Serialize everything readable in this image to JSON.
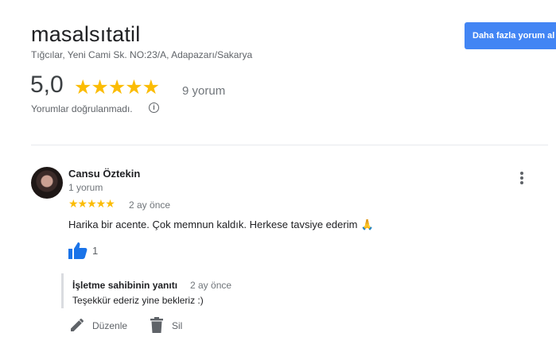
{
  "business": {
    "name": "masalsıtatil",
    "address": "Tığcılar, Yeni Cami Sk. NO:23/A, Adapazarı/Sakarya",
    "more_reviews_button": "Daha fazla yorum al"
  },
  "summary": {
    "rating": "5,0",
    "stars": "★★★★★",
    "review_count": "9 yorum",
    "verification_note": "Yorumlar doğrulanmadı.",
    "info_icon": "i"
  },
  "review": {
    "author": "Cansu Öztekin",
    "author_review_count": "1 yorum",
    "stars": "★★★★★",
    "time": "2 ay önce",
    "text": "Harika bir acente. Çok memnun kaldık. Herkese tavsiye ederim",
    "emoji": "🙏",
    "like_count": "1",
    "reply": {
      "owner_label": "İşletme sahibinin yanıtı",
      "time": "2 ay önce",
      "text": "Teşekkür ederiz yine bekleriz :)"
    },
    "actions": {
      "edit_label": "Düzenle",
      "delete_label": "Sil"
    }
  },
  "colors": {
    "accent": "#4285f4",
    "star": "#fbbc04"
  }
}
